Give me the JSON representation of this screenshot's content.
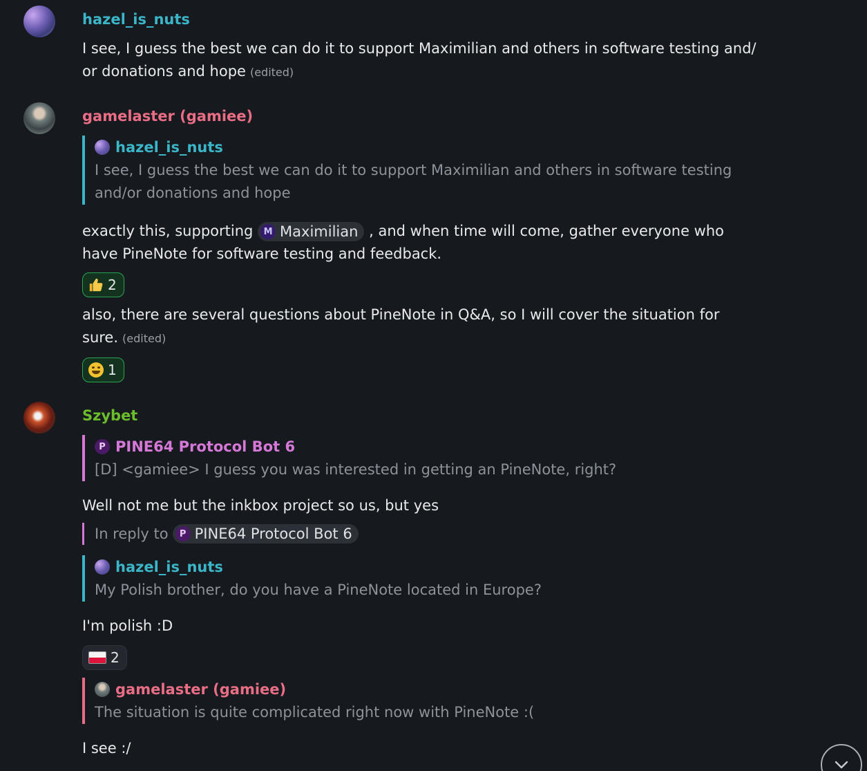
{
  "messages": {
    "m1": {
      "sender": "hazel_is_nuts",
      "lines": [
        "I see, I guess the best we can do it to support Maximilian and others in software testing and/",
        "or donations and hope"
      ],
      "edited": "(edited)"
    },
    "m2": {
      "sender": "gamelaster (gamiee)",
      "quote": {
        "sender": "hazel_is_nuts",
        "lines": [
          "I see, I guess the best we can do it to support Maximilian and others in software testing",
          "and/or donations and hope"
        ]
      },
      "text_before_mention": "exactly this, supporting",
      "mention": {
        "initial": "M",
        "name": "Maximilian"
      },
      "text_after_mention": ", and when time will come, gather everyone who",
      "line2": "have PineNote for software testing and feedback.",
      "reaction": {
        "emoji": "thumbs-up-icon",
        "count": "2"
      },
      "followup": {
        "lines": [
          "also, there are several questions about PineNote in Q&A, so I will cover the situation for",
          "sure."
        ],
        "edited": "(edited)",
        "reaction": {
          "emoji": "grinning-face-icon",
          "count": "1"
        }
      }
    },
    "m3": {
      "sender": "Szybet",
      "quote": {
        "initial": "P",
        "sender": "PINE64 Protocol Bot 6",
        "line": "[D] <gamiee> I guess you was interested in getting an PineNote, right?"
      },
      "text": "Well not me but the inkbox project so us, but yes",
      "in_reply_to": {
        "label": "In reply to",
        "initial": "P",
        "name": "PINE64 Protocol Bot 6"
      },
      "quote2": {
        "sender": "hazel_is_nuts",
        "line": "My Polish brother, do you have a PineNote located in Europe?"
      },
      "text2": "I'm polish :D",
      "reaction": {
        "emoji": "poland-flag-icon",
        "count": "2"
      },
      "quote3": {
        "sender": "gamelaster (gamiee)",
        "line": "The situation is quite complicated right now with PineNote :("
      },
      "text3": "I see :/"
    }
  },
  "colors": {
    "background": "#16191d",
    "hazel": "#3bb6c9",
    "gamelaster": "#ea6d86",
    "szybet": "#6cbd2b",
    "bot": "#d678d8",
    "reaction_active": "#2aa352"
  }
}
